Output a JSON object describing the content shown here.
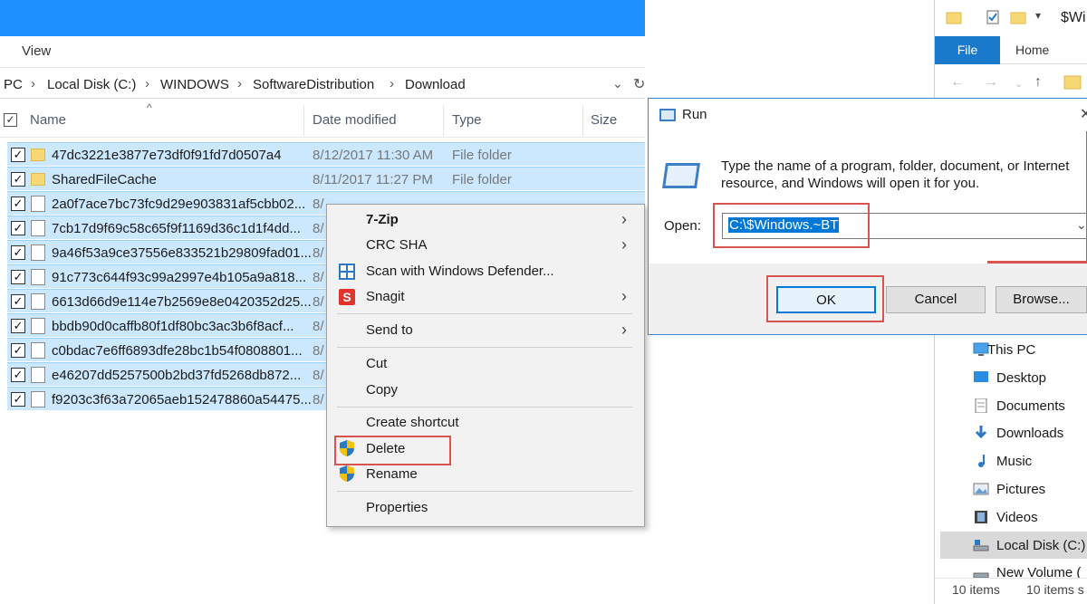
{
  "explorer": {
    "view_tab": "View",
    "breadcrumbs": [
      "PC",
      "Local Disk (C:)",
      "WINDOWS",
      "SoftwareDistribution",
      "Download"
    ],
    "columns": {
      "name": "Name",
      "date": "Date modified",
      "type": "Type",
      "size": "Size"
    },
    "rows": [
      {
        "name": "47dc3221e3877e73df0f91fd7d0507a4",
        "date": "8/12/2017 11:30 AM",
        "type": "File folder",
        "icon": "folder"
      },
      {
        "name": "SharedFileCache",
        "date": "8/11/2017 11:27 PM",
        "type": "File folder",
        "icon": "folder"
      },
      {
        "name": "2a0f7ace7bc73fc9d29e903831af5cbb02...",
        "date": "8/",
        "type": "",
        "icon": "file"
      },
      {
        "name": "7cb17d9f69c58c65f9f1169d36c1d1f4dd...",
        "date": "8/",
        "type": "",
        "icon": "file"
      },
      {
        "name": "9a46f53a9ce37556e833521b29809fad01...",
        "date": "8/",
        "type": "",
        "icon": "file"
      },
      {
        "name": "91c773c644f93c99a2997e4b105a9a818...",
        "date": "8/",
        "type": "",
        "icon": "file"
      },
      {
        "name": "6613d66d9e114e7b2569e8e0420352d25...",
        "date": "8/",
        "type": "",
        "icon": "file"
      },
      {
        "name": "bbdb90d0caffb80f1df80bc3ac3b6f8acf...",
        "date": "8/",
        "type": "",
        "icon": "file"
      },
      {
        "name": "c0bdac7e6ff6893dfe28bc1b54f0808801...",
        "date": "8/",
        "type": "",
        "icon": "file"
      },
      {
        "name": "e46207dd5257500b2bd37fd5268db872...",
        "date": "8/",
        "type": "",
        "icon": "file"
      },
      {
        "name": "f9203c3f63a72065aeb152478860a54475...",
        "date": "8/",
        "type": "",
        "icon": "file"
      }
    ]
  },
  "context_menu": {
    "items": [
      "7-Zip",
      "CRC SHA",
      "Scan with Windows Defender...",
      "Snagit",
      "Send to",
      "Cut",
      "Copy",
      "Create shortcut",
      "Delete",
      "Rename",
      "Properties"
    ]
  },
  "run_dialog": {
    "title": "Run",
    "description_line1": "Type the name of a program, folder, document, or Internet",
    "description_line2": "resource, and Windows will open it for you.",
    "open_label": "Open:",
    "open_value": "C:\\$Windows.~BT",
    "ok_label": "OK",
    "cancel_label": "Cancel",
    "browse_label": "Browse..."
  },
  "right_explorer": {
    "title": "$Wi",
    "file_tab": "File",
    "home_tab": "Home",
    "tree": [
      "This PC",
      "Desktop",
      "Documents",
      "Downloads",
      "Music",
      "Pictures",
      "Videos",
      "Local Disk (C:)",
      "New Volume ("
    ],
    "status_left": "10 items",
    "status_right": "10 items s"
  },
  "colors": {
    "title_blue": "#1e90ff",
    "selection": "#cce8ff",
    "highlight_red": "#d9534f",
    "accent": "#0078d7"
  }
}
